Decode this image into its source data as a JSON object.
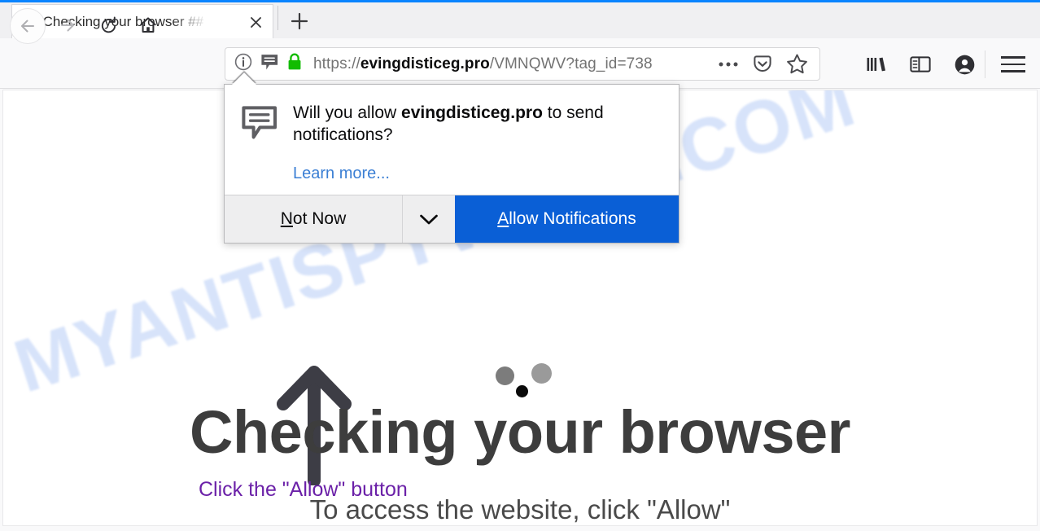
{
  "window": {
    "accent_color": "#0a84ff"
  },
  "tabbar": {
    "tab_title": "## Checking your browser ##",
    "close_icon": "close-icon",
    "newtab_icon": "plus-icon",
    "newtab_label": "+"
  },
  "navigation": {
    "back_icon": "back-arrow-icon",
    "forward_icon": "forward-arrow-icon",
    "reload_icon": "reload-icon",
    "home_icon": "home-icon"
  },
  "urlbar": {
    "identity_icon": "info-icon",
    "permission_icon": "notification-bubble-icon",
    "lock_icon": "padlock-icon",
    "lock_color": "#12bc00",
    "url_scheme": "https://",
    "url_host": "evingdisticeg.pro",
    "url_path": "/VMNQWV?tag_id=738",
    "page_actions_icon": "ellipsis-icon",
    "pocket_icon": "pocket-icon",
    "bookmark_icon": "star-icon"
  },
  "toolbar_right": {
    "library_icon": "library-icon",
    "sidebar_icon": "sidebar-icon",
    "account_icon": "account-avatar-icon",
    "menu_icon": "hamburger-menu-icon"
  },
  "popup": {
    "icon": "notification-bubble-icon",
    "question_prefix": "Will you allow ",
    "question_host": "evingdisticeg.pro",
    "question_suffix": " to send notifications?",
    "learn_more": "Learn more...",
    "not_now_accesskey": "N",
    "not_now_rest": "ot Now",
    "dropdown_icon": "chevron-down-icon",
    "allow_accesskey": "A",
    "allow_rest": "llow Notifications",
    "allow_button_color": "#0a5fd6"
  },
  "page": {
    "watermark": "MYANTISPYWARE.COM",
    "watermark_color": "#d7e3fa",
    "headline": "Checking your browser",
    "headline_color": "#3d3d3d",
    "allow_hint": "Click the \"Allow\" button",
    "allow_hint_color": "#6b21a8",
    "subline": "To access the website, click \"Allow\"",
    "arrow_icon": "up-arrow-icon",
    "loader_icon": "loading-dots-icon",
    "dot_colors": [
      "#7c7c7c",
      "#9a9a9a",
      "#0a0a0a"
    ]
  }
}
